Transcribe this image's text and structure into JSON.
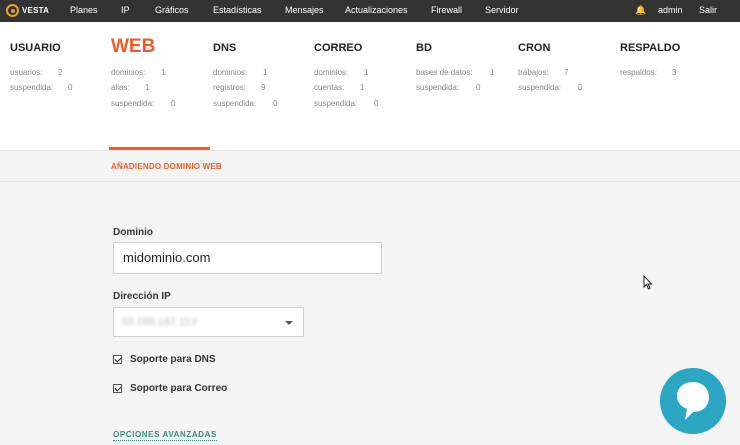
{
  "topbar": {
    "logo_text": "VESTA",
    "nav": [
      "Planes",
      "IP",
      "Gráficos",
      "Estadísticas",
      "Mensajes",
      "Actualizaciones",
      "Firewall",
      "Servidor"
    ],
    "user": "admin",
    "logout": "Salir"
  },
  "stats": [
    {
      "title": "USUARIO",
      "lines": [
        {
          "label": "usuarios:",
          "value": "2"
        },
        {
          "label": "suspendida:",
          "value": "0"
        }
      ]
    },
    {
      "title": "WEB",
      "active": true,
      "lines": [
        {
          "label": "dominios:",
          "value": "1"
        },
        {
          "label": "alias:",
          "value": "1"
        },
        {
          "label": "suspendida:",
          "value": "0"
        }
      ]
    },
    {
      "title": "DNS",
      "lines": [
        {
          "label": "dominios:",
          "value": "1"
        },
        {
          "label": "registros:",
          "value": "9"
        },
        {
          "label": "suspendida:",
          "value": "0"
        }
      ]
    },
    {
      "title": "CORREO",
      "lines": [
        {
          "label": "dominios:",
          "value": "1"
        },
        {
          "label": "cuentas:",
          "value": "1"
        },
        {
          "label": "suspendida:",
          "value": "0"
        }
      ]
    },
    {
      "title": "BD",
      "lines": [
        {
          "label": "bases de datos:",
          "value": "1"
        },
        {
          "label": "suspendida:",
          "value": "0"
        }
      ]
    },
    {
      "title": "CRON",
      "lines": [
        {
          "label": "trabajos:",
          "value": "7"
        },
        {
          "label": "suspendida:",
          "value": "0"
        }
      ]
    },
    {
      "title": "RESPALDO",
      "lines": [
        {
          "label": "respaldos:",
          "value": "3"
        }
      ]
    }
  ],
  "form": {
    "subtitle": "AÑADIENDO DOMINIO WEB",
    "domain_label": "Dominio",
    "domain_value": "midominio.com",
    "ip_label": "Dirección IP",
    "ip_value": "93.188.167.113",
    "dns_support_label": "Soporte para DNS",
    "mail_support_label": "Soporte para Correo",
    "advanced_link": "OPCIONES AVANZADAS"
  },
  "colors": {
    "accent": "#f05a28",
    "topbar": "#333333",
    "link": "#3a8c7a"
  }
}
